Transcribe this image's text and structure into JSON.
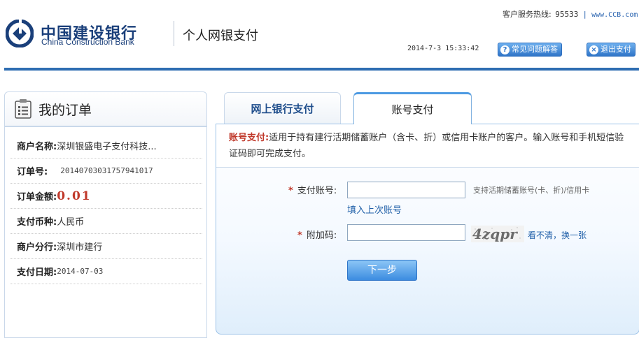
{
  "header": {
    "brand_cn": "中国建设银行",
    "brand_en": "China Construction Bank",
    "subtitle": "个人网银支付",
    "hotline_label": "客户服务热线:",
    "hotline_number": "95533",
    "website": "www.CCB.com",
    "datetime": "2014-7-3 15:33:42",
    "faq_button": "常见问题解答",
    "exit_button": "退出支付",
    "accent_color": "#2e6db2"
  },
  "order": {
    "title": "我的订单",
    "rows": [
      {
        "label": "商户名称:",
        "value": "深圳银盛电子支付科技..."
      },
      {
        "label": "订单号:",
        "value": "20140703031757941017"
      },
      {
        "label": "订单金额:",
        "value": "0.01"
      },
      {
        "label": "支付币种:",
        "value": "人民币"
      },
      {
        "label": "商户分行:",
        "value": "深圳市建行"
      },
      {
        "label": "支付日期:",
        "value": "2014-07-03"
      }
    ]
  },
  "tabs": [
    {
      "label": "网上银行支付",
      "active": false
    },
    {
      "label": "账号支付",
      "active": true
    }
  ],
  "payment": {
    "notice_label": "账号支付:",
    "notice_text": "适用于持有建行活期储蓄账户（含卡、折）或信用卡账户的客户。输入账号和手机短信验证码即可完成支付。",
    "account_label": "支付账号:",
    "account_value": "",
    "account_hint": "支持活期储蓄账号(卡、折)/信用卡",
    "fill_last_link": "填入上次账号",
    "captcha_label": "附加码:",
    "captcha_value": "",
    "captcha_text": "4zqpr",
    "refresh_link": "看不清，换一张",
    "required_mark": "*",
    "next_button": "下一步"
  }
}
